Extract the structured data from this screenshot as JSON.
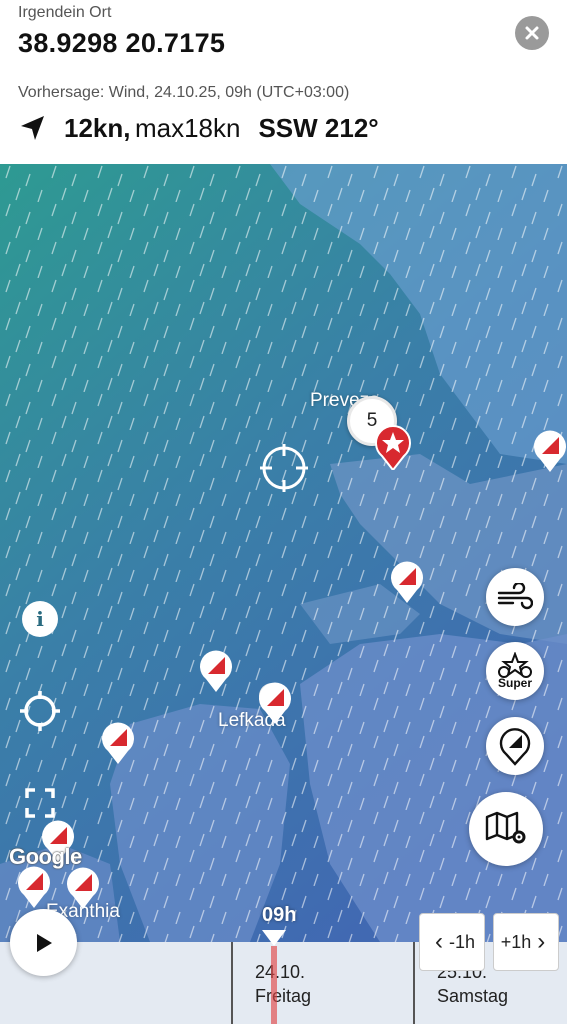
{
  "header": {
    "place": "Irgendein Ort",
    "coordinates": "38.9298 20.7175",
    "forecast": "Vorhersage: Wind, 24.10.25, 09h (UTC+03:00)",
    "speed": "12kn,",
    "max": "max18kn",
    "direction": "SSW 212°"
  },
  "map": {
    "labels": {
      "preveza": "Preveza",
      "lefkada": "Lefkada",
      "exanthia": "Exanthia"
    },
    "cluster_count": "5",
    "attribution": "Google",
    "super_label": "Super",
    "info_label": "i"
  },
  "timeline": {
    "current_hour": "09h",
    "day1_date": "24.10.",
    "day1_name": "Freitag",
    "day2_date": "25.10.",
    "day2_name": "Samstag",
    "minus_label": "-1h",
    "plus_label": "+1h"
  },
  "colors": {
    "accent_red": "#d8292f",
    "map_sea_top": "#2e9a92",
    "map_sea_bottom": "#4169b2",
    "land": "#6f95c6"
  },
  "icons": [
    "close-icon",
    "navigation-arrow-icon",
    "crosshair-icon",
    "kitespot-icon",
    "favorite-star-icon",
    "wind-icon",
    "super-forecast-icon",
    "compass-icon",
    "map-layers-icon",
    "info-icon",
    "locate-icon",
    "fullscreen-icon",
    "play-icon",
    "chevron-left-icon",
    "chevron-right-icon"
  ]
}
